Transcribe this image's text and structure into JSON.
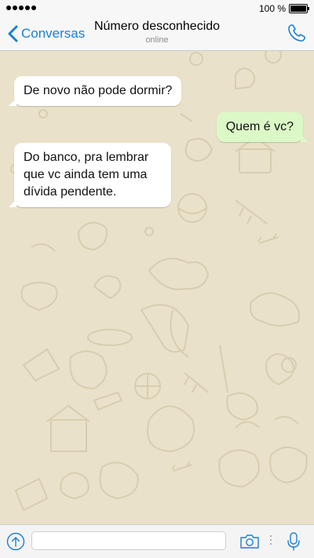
{
  "status_bar": {
    "battery_text": "100 %"
  },
  "nav": {
    "back_label": "Conversas",
    "title": "Número desconhecido",
    "subtitle": "online"
  },
  "messages": [
    {
      "direction": "incoming",
      "text": "De novo não pode dormir?"
    },
    {
      "direction": "outgoing",
      "text": "Quem é vc?"
    },
    {
      "direction": "incoming",
      "text": "Do banco, pra lembrar que vc ainda tem uma dívida pendente."
    }
  ],
  "input_bar": {
    "message_value": "",
    "icons": [
      "attach-arrow-icon",
      "camera-icon",
      "microphone-icon"
    ]
  },
  "colors": {
    "accent": "#1a7fd6",
    "chat_background": "#e9e1c9",
    "incoming_bubble": "#ffffff",
    "outgoing_bubble": "#dcf8c6"
  }
}
